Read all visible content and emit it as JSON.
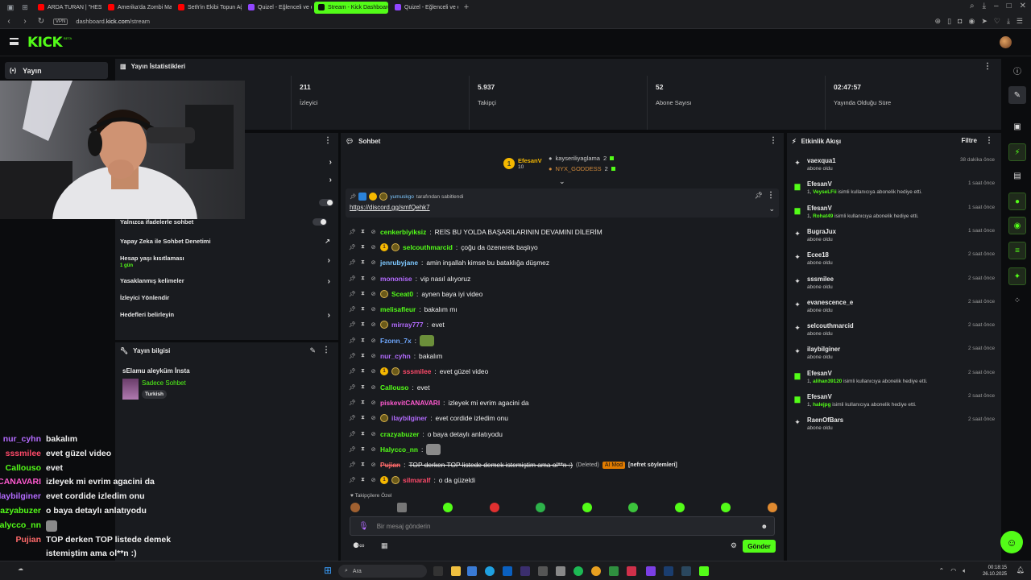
{
  "browser": {
    "tabs": [
      {
        "label": "ARDA TURAN | \"HESAP V",
        "color": "#ff0000",
        "active": false
      },
      {
        "label": "Amerika'da Zombi Mahsll",
        "color": "#ff0000",
        "active": false
      },
      {
        "label": "Seth'in Ekibi Topun Ağzın",
        "color": "#ff0000",
        "active": false
      },
      {
        "label": "Quizel - Eğlenceli ve etkil",
        "color": "#9146ff",
        "active": false
      },
      {
        "label": "Stream - Kick Dashboard",
        "color": "#53fc18",
        "active": true
      },
      {
        "label": "Quizel - Eğlenceli ve etkil",
        "color": "#9146ff",
        "active": false
      }
    ],
    "url_prefix": "dashboard.",
    "url_domain": "kick.com",
    "url_path": "/stream",
    "vpn": "VPN"
  },
  "app": {
    "logo": "KICK",
    "beta": "BETA",
    "nav_item": "Yayın"
  },
  "stats": {
    "title": "Yayın İstatistikleri",
    "items": [
      {
        "value": "211",
        "label": "İzleyici"
      },
      {
        "value": "5.937",
        "label": "Takipçi"
      },
      {
        "value": "52",
        "label": "Abone Sayısı"
      },
      {
        "value": "02:47:57",
        "label": "Yayında Olduğu Süre"
      }
    ]
  },
  "moderation": {
    "rows": [
      {
        "label": "Yalnızca ifadelerle sohbet"
      },
      {
        "label": "Yapay Zeka ile Sohbet Denetimi"
      },
      {
        "label": "Hesap yaşı kısıtlaması",
        "sub": "1 gün"
      },
      {
        "label": "Yasaklanmış kelimeler"
      },
      {
        "label": "İzleyici Yönlendir"
      },
      {
        "label": "Hedefleri belirleyin"
      }
    ]
  },
  "stream_info": {
    "title": "Yayın bilgisi",
    "stream_title": "sElamu aleyküm İnsta",
    "category": "Sadece Sohbet",
    "tag": "Turkish"
  },
  "chat": {
    "title": "Sohbet",
    "leaders": [
      {
        "name": "EfesanV",
        "count": "10"
      },
      {
        "name": "kayseriliyaglama",
        "count": "2"
      },
      {
        "name": "NYX_GODDESS",
        "count": "2"
      }
    ],
    "pinned_by": "yumuskgo",
    "pinned_by_suffix": "tarafından sabitlendi",
    "pinned_link": "https://discord.gg/smfQehk7",
    "messages": [
      {
        "user": "cenkerbiyiksiz",
        "color": "#53fc18",
        "text": "REİS BU YOLDA BAŞARILARININ DEVAMINI DİLERİM",
        "badges": []
      },
      {
        "user": "selcouthmarcid",
        "color": "#53fc18",
        "text": "çoğu da özenerek başlıyo",
        "badges": [
          "gold",
          "sub"
        ]
      },
      {
        "user": "jenrubyjane",
        "color": "#7ec8ff",
        "text": "amin inşallah kimse bu bataklığa düşmez",
        "badges": []
      },
      {
        "user": "mononise",
        "color": "#b46bff",
        "text": "vip nasıl alıyoruz",
        "badges": []
      },
      {
        "user": "Sceat0",
        "color": "#53fc18",
        "text": "aynen baya iyi video",
        "badges": [
          "sub"
        ]
      },
      {
        "user": "melisafleur",
        "color": "#53fc18",
        "text": "bakalım mı",
        "badges": []
      },
      {
        "user": "mirray777",
        "color": "#b46bff",
        "text": "evet",
        "badges": [
          "sub"
        ]
      },
      {
        "user": "Fzonn_7x",
        "color": "#6fa8ff",
        "text": "",
        "badges": [],
        "emote": "#6b8f3a"
      },
      {
        "user": "nur_cyhn",
        "color": "#b46bff",
        "text": "bakalım",
        "badges": []
      },
      {
        "user": "sssmilee",
        "color": "#ff4a6a",
        "text": "evet güzel video",
        "badges": [
          "gold",
          "sub"
        ]
      },
      {
        "user": "Callouso",
        "color": "#53fc18",
        "text": "evet",
        "badges": []
      },
      {
        "user": "piskevitCANAVARI",
        "color": "#ff5ad0",
        "text": "izleyek mi evrim agacini da",
        "badges": []
      },
      {
        "user": "ilaybilginer",
        "color": "#b46bff",
        "text": "evet cordide izledim onu",
        "badges": [
          "sub"
        ]
      },
      {
        "user": "crazyabuzer",
        "color": "#53fc18",
        "text": "o baya detaylı anlatıyodu",
        "badges": []
      },
      {
        "user": "Halycco_nn",
        "color": "#53fc18",
        "text": "",
        "badges": [],
        "emote": "#8a8a8a"
      },
      {
        "user": "Pujian",
        "color": "#ff6a6a",
        "text": "TOP derken TOP listede demek istemiştim ama ol**n :)",
        "badges": [],
        "deleted": "(Deleted)",
        "ai": "AI Mod",
        "reason": "[nefret söylemleri]"
      },
      {
        "user": "silmaralf",
        "color": "#ff4a6a",
        "text": "o da güzeldi",
        "badges": [
          "gold",
          "sub"
        ]
      }
    ],
    "follower_only": "Takipçilere Özel",
    "input_placeholder": "Bir mesaj gönderin",
    "send": "Gönder"
  },
  "activity": {
    "title": "Etkinlik Akışı",
    "filter": "Filtre",
    "items": [
      {
        "name": "vaexqua1",
        "sub": "abone oldu",
        "time": "38 dakika önce",
        "gift": false
      },
      {
        "name": "EfesanV",
        "gifted_to": "VeyseLFii",
        "sub": "isimli kullanıcıya abonelik hediye etti.",
        "time": "1 saat önce",
        "gift": true
      },
      {
        "name": "EfesanV",
        "gifted_to": "Rohat49",
        "sub": "isimli kullanıcıya abonelik hediye etti.",
        "time": "1 saat önce",
        "gift": true
      },
      {
        "name": "BugraJux",
        "sub": "abone oldu",
        "time": "1 saat önce",
        "gift": false
      },
      {
        "name": "Ecee18",
        "sub": "abone oldu",
        "time": "2 saat önce",
        "gift": false
      },
      {
        "name": "sssmilee",
        "sub": "abone oldu",
        "time": "2 saat önce",
        "gift": false
      },
      {
        "name": "evanescence_e",
        "sub": "abone oldu",
        "time": "2 saat önce",
        "gift": false
      },
      {
        "name": "selcouthmarcid",
        "sub": "abone oldu",
        "time": "2 saat önce",
        "gift": false
      },
      {
        "name": "ilaybilginer",
        "sub": "abone oldu",
        "time": "2 saat önce",
        "gift": false
      },
      {
        "name": "EfesanV",
        "gifted_to": "alihan39120",
        "sub": "isimli kullanıcıya abonelik hediye etti.",
        "time": "2 saat önce",
        "gift": true
      },
      {
        "name": "EfesanV",
        "gifted_to": "halejpg",
        "sub": "isimli kullanıcıya abonelik hediye etti.",
        "time": "2 saat önce",
        "gift": true
      },
      {
        "name": "RaenOfBars",
        "sub": "abone oldu",
        "time": "2 saat önce",
        "gift": false
      }
    ]
  },
  "overlay_chat": [
    {
      "name": "nur_cyhn",
      "color": "#b46bff",
      "text": "bakalım"
    },
    {
      "name": "sssmilee",
      "color": "#ff4a6a",
      "text": "evet güzel video"
    },
    {
      "name": "Callouso",
      "color": "#53fc18",
      "text": "evet"
    },
    {
      "name": "CANAVARI",
      "color": "#ff5ad0",
      "text": "izleyek mi evrim agacini da"
    },
    {
      "name": "laybilginer",
      "color": "#b46bff",
      "text": "evet cordide izledim onu"
    },
    {
      "name": "razyabuzer",
      "color": "#53fc18",
      "text": "o baya detaylı anlatıyodu"
    },
    {
      "name": "Halycco_nn",
      "color": "#53fc18",
      "text": ""
    },
    {
      "name": "Pujian",
      "color": "#ff6a6a",
      "text": "TOP derken TOP listede demek"
    },
    {
      "name": "",
      "color": "#ff6a6a",
      "text": "istemiştim ama ol**n :)"
    },
    {
      "name": "silmaralf",
      "color": "#ff4a6a",
      "text": "o da güzeldi"
    }
  ],
  "taskbar": {
    "search": "Ara",
    "time": "00:18:15",
    "date": "26.10.2025"
  }
}
